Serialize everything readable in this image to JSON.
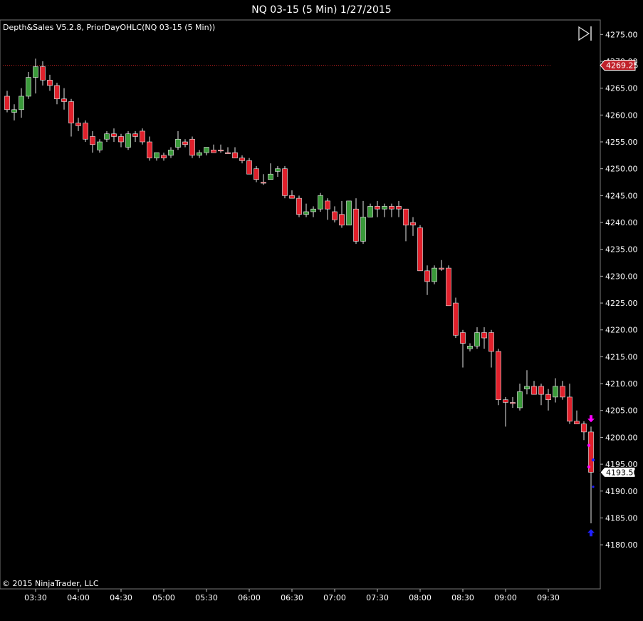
{
  "window": {
    "title": "NQ 03-15 (5 Min)  1/27/2015"
  },
  "indicator_label": "Depth&Sales V5.2.8, PriorDayOHLC(NQ 03-15 (5 Min))",
  "copyright": "© 2015 NinjaTrader, LLC",
  "colors": {
    "up": "#3a9a3a",
    "down": "#e0202b",
    "prior_line": "#c02020",
    "price_tag": "#c0202a",
    "marker_magenta": "#ff00ff",
    "marker_blue": "#2020ff"
  },
  "chart_data": {
    "type": "candlestick",
    "y_ticks": [
      "4275.00",
      "4270.00",
      "4265.00",
      "4260.00",
      "4255.00",
      "4250.00",
      "4245.00",
      "4240.00",
      "4235.00",
      "4230.00",
      "4225.00",
      "4220.00",
      "4215.00",
      "4210.00",
      "4205.00",
      "4200.00",
      "4195.00",
      "4190.00",
      "4185.00",
      "4180.00"
    ],
    "ylim": [
      4176.3,
      4276.5
    ],
    "x_labels": [
      "03:30",
      "04:00",
      "04:30",
      "05:00",
      "05:30",
      "06:00",
      "06:30",
      "07:00",
      "07:30",
      "08:00",
      "08:30",
      "09:00",
      "09:30"
    ],
    "prior_day_line": {
      "value": 4269.25,
      "label": "4269.25"
    },
    "last_price": {
      "value": 4193.5,
      "label": "4193.50"
    },
    "candles": [
      [
        4263.5,
        4264.5,
        4260.5,
        4261.0
      ],
      [
        4260.5,
        4262.0,
        4259.0,
        4261.0
      ],
      [
        4261.0,
        4265.0,
        4259.5,
        4263.5
      ],
      [
        4263.5,
        4268.0,
        4263.0,
        4267.0
      ],
      [
        4267.0,
        4270.5,
        4264.0,
        4269.0
      ],
      [
        4269.0,
        4270.0,
        4265.5,
        4266.5
      ],
      [
        4266.5,
        4267.5,
        4264.5,
        4265.5
      ],
      [
        4265.5,
        4266.0,
        4262.0,
        4263.0
      ],
      [
        4263.0,
        4265.0,
        4261.0,
        4262.5
      ],
      [
        4262.5,
        4263.0,
        4256.0,
        4258.5
      ],
      [
        4258.5,
        4259.5,
        4257.0,
        4258.0
      ],
      [
        4258.5,
        4259.0,
        4255.0,
        4255.5
      ],
      [
        4256.0,
        4257.0,
        4253.0,
        4254.5
      ],
      [
        4253.5,
        4255.5,
        4253.0,
        4255.0
      ],
      [
        4255.5,
        4257.0,
        4255.0,
        4256.5
      ],
      [
        4256.5,
        4257.5,
        4255.0,
        4256.0
      ],
      [
        4256.0,
        4256.5,
        4254.0,
        4255.0
      ],
      [
        4254.0,
        4257.0,
        4253.5,
        4256.5
      ],
      [
        4256.5,
        4257.0,
        4255.0,
        4256.0
      ],
      [
        4257.0,
        4257.5,
        4254.5,
        4255.0
      ],
      [
        4255.0,
        4256.0,
        4251.5,
        4252.0
      ],
      [
        4252.0,
        4253.0,
        4251.5,
        4253.0
      ],
      [
        4252.5,
        4253.0,
        4251.5,
        4252.0
      ],
      [
        4252.5,
        4254.0,
        4252.0,
        4253.5
      ],
      [
        4254.0,
        4257.0,
        4253.5,
        4255.5
      ],
      [
        4255.0,
        4255.5,
        4254.0,
        4254.5
      ],
      [
        4255.5,
        4256.0,
        4252.0,
        4252.5
      ],
      [
        4252.5,
        4253.5,
        4252.0,
        4253.0
      ],
      [
        4253.0,
        4254.0,
        4252.5,
        4254.0
      ],
      [
        4253.5,
        4254.5,
        4253.0,
        4253.0
      ],
      [
        4253.5,
        4254.5,
        4253.0,
        4253.5
      ],
      [
        4253.0,
        4254.0,
        4253.0,
        4253.0
      ],
      [
        4253.0,
        4254.0,
        4252.0,
        4252.0
      ],
      [
        4252.0,
        4252.5,
        4251.0,
        4251.5
      ],
      [
        4251.5,
        4252.0,
        4249.0,
        4249.0
      ],
      [
        4250.0,
        4250.5,
        4247.5,
        4248.0
      ],
      [
        4247.5,
        4249.0,
        4247.0,
        4247.5
      ],
      [
        4248.0,
        4251.0,
        4248.0,
        4249.0
      ],
      [
        4249.5,
        4250.5,
        4248.5,
        4250.0
      ],
      [
        4250.0,
        4250.5,
        4244.5,
        4245.0
      ],
      [
        4245.0,
        4246.0,
        4244.5,
        4244.5
      ],
      [
        4244.5,
        4245.0,
        4241.0,
        4241.5
      ],
      [
        4241.5,
        4243.5,
        4241.0,
        4242.0
      ],
      [
        4242.0,
        4243.0,
        4241.0,
        4242.5
      ],
      [
        4242.5,
        4245.5,
        4242.0,
        4245.0
      ],
      [
        4244.0,
        4244.5,
        4240.5,
        4242.5
      ],
      [
        4242.0,
        4243.0,
        4240.0,
        4240.5
      ],
      [
        4241.5,
        4244.0,
        4239.0,
        4239.5
      ],
      [
        4239.5,
        4244.0,
        4239.5,
        4244.0
      ],
      [
        4242.5,
        4244.5,
        4236.0,
        4236.5
      ],
      [
        4236.5,
        4244.0,
        4236.0,
        4241.0
      ],
      [
        4241.0,
        4243.5,
        4241.0,
        4243.0
      ],
      [
        4243.0,
        4244.0,
        4241.0,
        4242.5
      ],
      [
        4242.5,
        4243.5,
        4241.0,
        4243.0
      ],
      [
        4243.0,
        4243.5,
        4241.0,
        4242.5
      ],
      [
        4243.0,
        4244.0,
        4241.0,
        4242.5
      ],
      [
        4242.5,
        4242.5,
        4236.5,
        4239.5
      ],
      [
        4240.0,
        4241.0,
        4237.5,
        4239.5
      ],
      [
        4239.0,
        4239.5,
        4231.0,
        4231.0
      ],
      [
        4231.0,
        4232.0,
        4226.5,
        4229.0
      ],
      [
        4229.0,
        4232.0,
        4228.5,
        4231.5
      ],
      [
        4231.5,
        4233.0,
        4231.0,
        4231.5
      ],
      [
        4231.5,
        4232.0,
        4224.5,
        4224.5
      ],
      [
        4225.0,
        4226.0,
        4218.5,
        4219.0
      ],
      [
        4219.5,
        4220.0,
        4213.0,
        4217.5
      ],
      [
        4216.5,
        4217.5,
        4216.0,
        4217.0
      ],
      [
        4217.0,
        4220.5,
        4216.5,
        4219.5
      ],
      [
        4219.5,
        4220.5,
        4216.5,
        4218.5
      ],
      [
        4219.5,
        4220.0,
        4213.0,
        4216.0
      ],
      [
        4216.0,
        4216.5,
        4206.0,
        4207.0
      ],
      [
        4207.0,
        4207.5,
        4202.0,
        4206.5
      ],
      [
        4206.5,
        4207.5,
        4205.5,
        4206.5
      ],
      [
        4205.5,
        4210.0,
        4205.0,
        4208.5
      ],
      [
        4209.0,
        4212.5,
        4208.0,
        4209.5
      ],
      [
        4209.5,
        4210.5,
        4208.0,
        4208.0
      ],
      [
        4209.5,
        4210.0,
        4206.0,
        4208.0
      ],
      [
        4208.0,
        4209.0,
        4205.0,
        4207.0
      ],
      [
        4207.5,
        4211.0,
        4206.5,
        4209.5
      ],
      [
        4209.5,
        4210.5,
        4207.0,
        4207.5
      ],
      [
        4207.5,
        4210.0,
        4202.5,
        4203.0
      ],
      [
        4203.0,
        4205.0,
        4202.5,
        4202.5
      ],
      [
        4202.5,
        4203.0,
        4199.5,
        4201.0
      ],
      [
        4201.0,
        4202.0,
        4184.0,
        4193.5
      ]
    ]
  }
}
